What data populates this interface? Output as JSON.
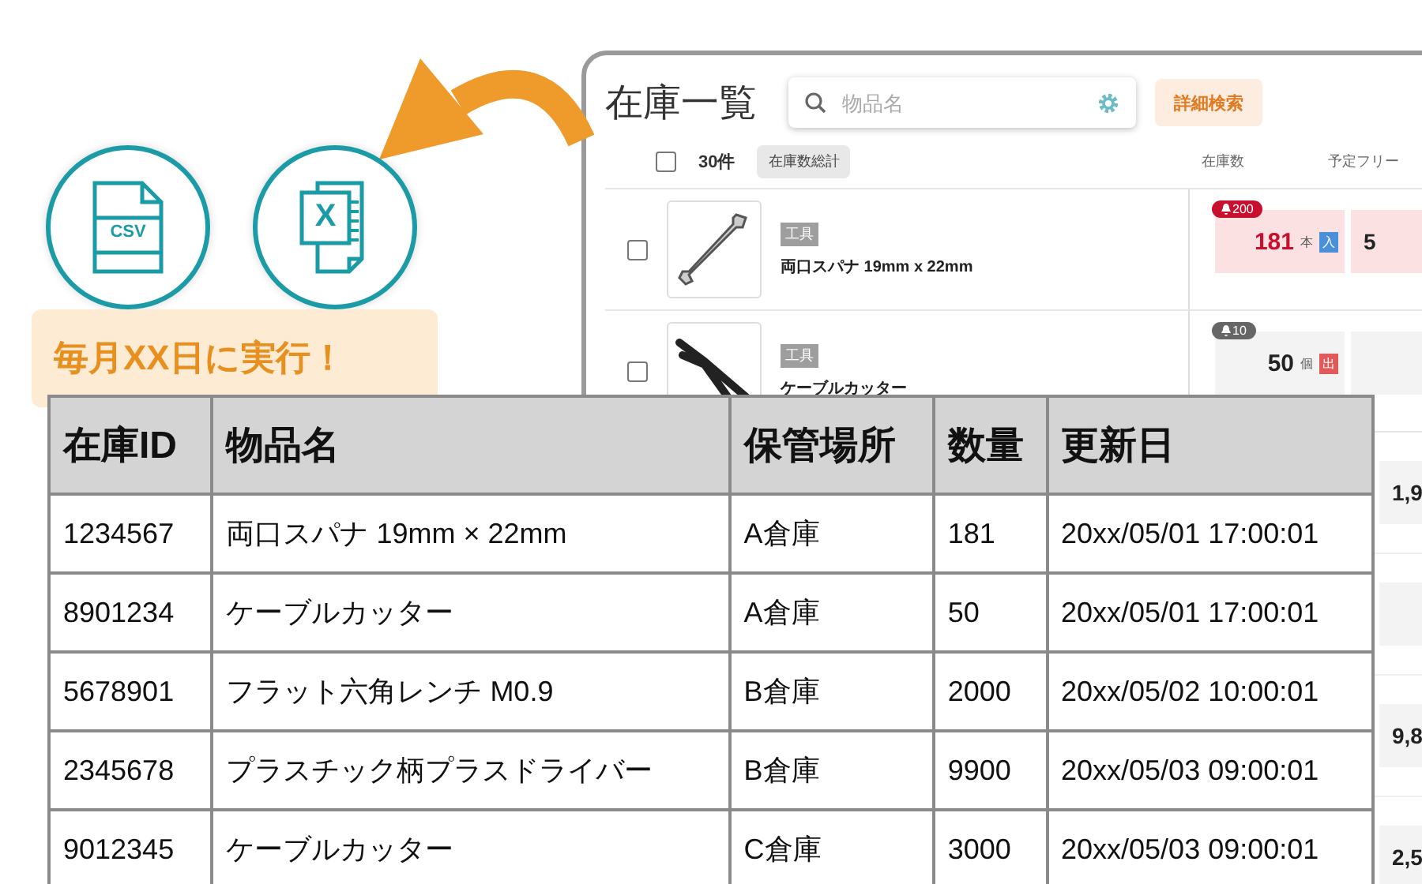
{
  "app": {
    "title": "在庫一覧",
    "search": {
      "placeholder": "物品名"
    },
    "advanced_button": "詳細検索",
    "header": {
      "checked": false,
      "count": "30件",
      "total_chip": "在庫数総計",
      "columns": [
        "在庫数",
        "予定フリー"
      ]
    },
    "rows": [
      {
        "checked": false,
        "kind": "inbound",
        "category": "工具",
        "name": "両口スパナ 19mm x 22mm",
        "alert": true,
        "threshold": "200",
        "stock": "181",
        "unit": "本",
        "tag": "入",
        "free": "5"
      },
      {
        "checked": false,
        "kind": "outbound",
        "category": "工具",
        "name": "ケーブルカッター",
        "alert": false,
        "threshold": "10",
        "stock": "50",
        "unit": "個",
        "tag": "出"
      }
    ],
    "hidden_rows": [
      {
        "kind": "value",
        "free": "1,9"
      },
      {
        "kind": "blank"
      },
      {
        "kind": "value",
        "free": "9,8"
      },
      {
        "kind": "value",
        "free": "2,5"
      }
    ]
  },
  "export": {
    "formats": [
      {
        "kind": "csv",
        "label": "CSV"
      },
      {
        "kind": "excel",
        "label": "X"
      }
    ],
    "schedule_label": "毎月XX日に実行！"
  },
  "table": {
    "columns": [
      "在庫ID",
      "物品名",
      "保管場所",
      "数量",
      "更新日"
    ],
    "rows": [
      [
        "1234567",
        "両口スパナ 19mm × 22mm",
        "A倉庫",
        "181",
        "20xx/05/01 17:00:01"
      ],
      [
        "8901234",
        "ケーブルカッター",
        "A倉庫",
        "50",
        "20xx/05/01 17:00:01"
      ],
      [
        "5678901",
        "フラット六角レンチ M0.9",
        "B倉庫",
        "2000",
        "20xx/05/02 10:00:01"
      ],
      [
        "2345678",
        "プラスチック柄プラスドライバー",
        "B倉庫",
        "9900",
        "20xx/05/03 09:00:01"
      ],
      [
        "9012345",
        "ケーブルカッター",
        "C倉庫",
        "3000",
        "20xx/05/03 09:00:01"
      ]
    ]
  }
}
